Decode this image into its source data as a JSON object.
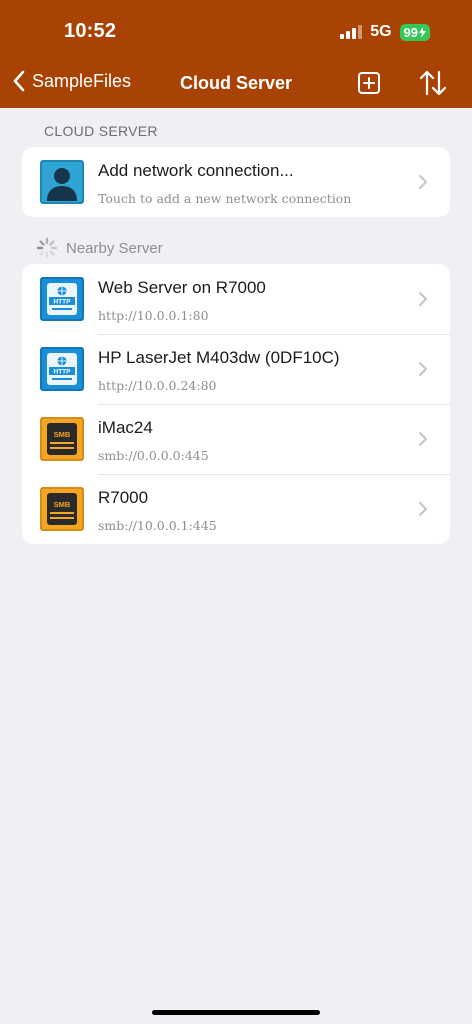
{
  "status": {
    "time": "10:52",
    "network": "5G",
    "battery": "99"
  },
  "nav": {
    "back_label": "SampleFiles",
    "title": "Cloud Server"
  },
  "cloud_section": {
    "header": "CLOUD SERVER",
    "add_item": {
      "title": "Add network connection...",
      "subtitle": "Touch to add a new network connection"
    }
  },
  "nearby_section": {
    "header": "Nearby Server",
    "servers": [
      {
        "title": "Web Server on R7000",
        "subtitle": "http://10.0.0.1:80",
        "protocol": "HTTP"
      },
      {
        "title": "HP LaserJet M403dw (0DF10C)",
        "subtitle": "http://10.0.0.24:80",
        "protocol": "HTTP"
      },
      {
        "title": "iMac24",
        "subtitle": "smb://0.0.0.0:445",
        "protocol": "SMB"
      },
      {
        "title": "R7000",
        "subtitle": "smb://10.0.0.1:445",
        "protocol": "SMB"
      }
    ]
  },
  "colors": {
    "header_bg": "#a84305",
    "http_icon": "#1a8fd8",
    "smb_icon": "#f5a524",
    "battery": "#34c759"
  }
}
